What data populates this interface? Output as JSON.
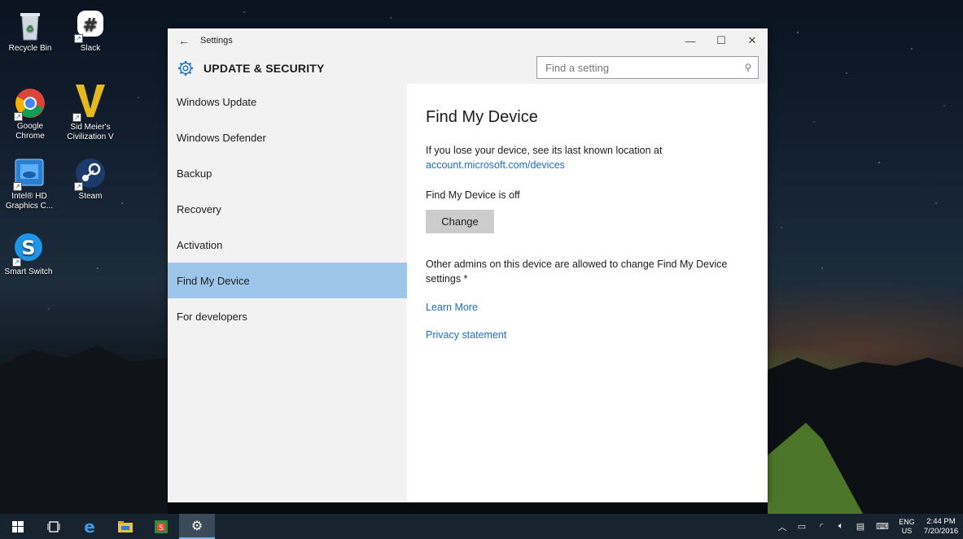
{
  "desktop": {
    "icons": [
      {
        "label": "Recycle Bin"
      },
      {
        "label": "Slack"
      },
      {
        "label": "Google Chrome"
      },
      {
        "label": "Sid Meier's Civilization V"
      },
      {
        "label": "Intel® HD Graphics C..."
      },
      {
        "label": "Steam"
      },
      {
        "label": "Smart Switch"
      }
    ]
  },
  "window": {
    "title": "Settings",
    "section_title": "UPDATE & SECURITY",
    "search": {
      "placeholder": "Find a setting"
    },
    "nav": [
      {
        "label": "Windows Update"
      },
      {
        "label": "Windows Defender"
      },
      {
        "label": "Backup"
      },
      {
        "label": "Recovery"
      },
      {
        "label": "Activation"
      },
      {
        "label": "Find My Device",
        "selected": true
      },
      {
        "label": "For developers"
      }
    ],
    "content": {
      "heading": "Find My Device",
      "intro": "If you lose your device, see its last known location at",
      "account_link": "account.microsoft.com/devices",
      "status": "Find My Device is off",
      "change_label": "Change",
      "admins_text": "Other admins on this device are allowed to change Find My Device settings *",
      "learn_more": "Learn More",
      "privacy": "Privacy statement"
    }
  },
  "taskbar": {
    "lang": "ENG",
    "region": "US",
    "time": "2:44 PM",
    "date": "7/20/2016"
  },
  "colors": {
    "accent": "#1a73c8",
    "selected_nav": "#9ec6ea",
    "link": "#1a6fc4"
  }
}
